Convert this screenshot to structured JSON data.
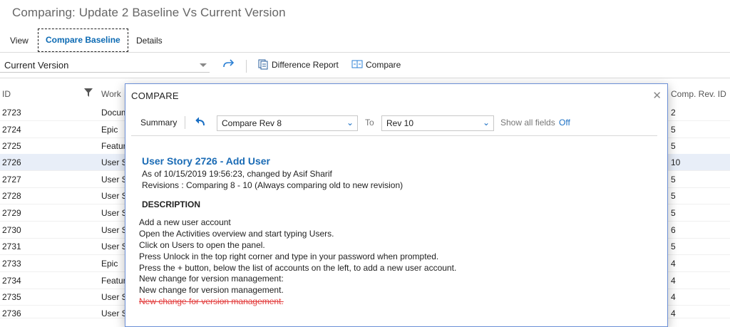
{
  "page": {
    "title": "Comparing: Update 2 Baseline Vs Current Version"
  },
  "tabs": [
    {
      "label": "View"
    },
    {
      "label": "Compare Baseline"
    },
    {
      "label": "Details"
    }
  ],
  "toolbar": {
    "version_select": "Current Version",
    "difference_report": "Difference Report",
    "compare": "Compare"
  },
  "grid": {
    "headers": {
      "id": "ID",
      "work": "Work",
      "comp_rev": "Comp. Rev. ID"
    },
    "rows": [
      {
        "id": "2723",
        "type": "Document",
        "rev": "2"
      },
      {
        "id": "2724",
        "type": "Epic",
        "rev": "5"
      },
      {
        "id": "2725",
        "type": "Feature",
        "rev": "5"
      },
      {
        "id": "2726",
        "type": "User Story",
        "rev": "10"
      },
      {
        "id": "2727",
        "type": "User Story",
        "rev": "5"
      },
      {
        "id": "2728",
        "type": "User Story",
        "rev": "5"
      },
      {
        "id": "2729",
        "type": "User Story",
        "rev": "5"
      },
      {
        "id": "2730",
        "type": "User Story",
        "rev": "6"
      },
      {
        "id": "2731",
        "type": "User Story",
        "rev": "5"
      },
      {
        "id": "2733",
        "type": "Epic",
        "rev": "4"
      },
      {
        "id": "2734",
        "type": "Feature",
        "rev": "4"
      },
      {
        "id": "2735",
        "type": "User Story",
        "rev": "4"
      },
      {
        "id": "2736",
        "type": "User Story",
        "rev": "4"
      }
    ]
  },
  "dialog": {
    "title": "COMPARE",
    "summary": "Summary",
    "from_rev": "Compare Rev 8",
    "to_label": "To",
    "to_rev": "Rev 10",
    "show_all_fields": "Show all fields",
    "show_all_state": "Off",
    "story_title": "User Story 2726 - Add User",
    "as_of": "As of 10/15/2019 19:56:23, changed by Asif Sharif",
    "revisions": "Revisions : Comparing 8 - 10 (Always comparing old to new revision)",
    "description_heading": "DESCRIPTION",
    "description_lines": [
      "Add a new user account",
      "Open the Activities overview and start typing Users.",
      "Click on Users to open the panel.",
      "Press Unlock in the top right corner and type in your password when prompted.",
      "Press the + button, below the list of accounts on the left, to add a new user account.",
      "New change for version management:",
      "New change for version management."
    ],
    "deleted_line": "New change for version management."
  },
  "colors": {
    "accent": "#0c6ab3",
    "link_title": "#1a6bb5",
    "deleted": "#e23b3b",
    "dialog_border": "#6b8fd6"
  },
  "icons": [
    "redo-icon",
    "difference-report-icon",
    "compare-icon",
    "filter-icon",
    "close-icon",
    "undo-icon",
    "chevron-down-icon"
  ]
}
